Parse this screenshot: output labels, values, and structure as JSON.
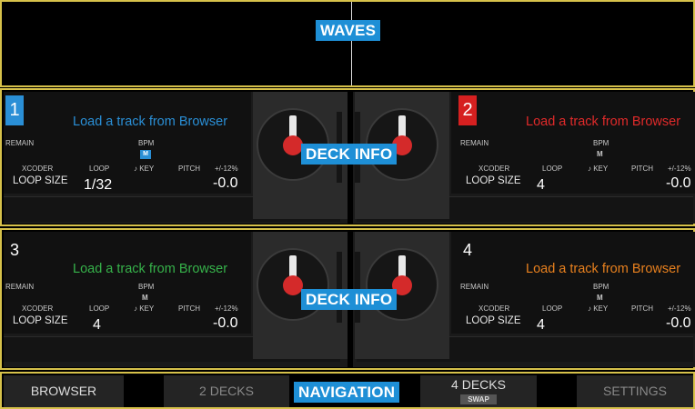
{
  "overlays": {
    "waves": "WAVES",
    "deck_info": "DECK INFO",
    "navigation": "NAVIGATION"
  },
  "decks": [
    {
      "number": "1",
      "number_color": "#2a8fd6",
      "title": "Load a track from Browser",
      "title_color": "#2a8fd6",
      "remain_label": "REMAIN",
      "bpm_label": "BPM",
      "bpm_badge": "M",
      "xcoder_label": "XCODER",
      "loop_label": "LOOP",
      "key_label": "♪ KEY",
      "pitch_label": "PITCH",
      "range_label": "+/-12%",
      "loop_size_label": "LOOP SIZE",
      "loop_size_value": "1/32",
      "pitch_value": "-0.0"
    },
    {
      "number": "2",
      "number_color": "#d62020",
      "title": "Load a track from Browser",
      "title_color": "#e02a2a",
      "remain_label": "REMAIN",
      "bpm_label": "BPM",
      "bpm_badge": "M",
      "xcoder_label": "XCODER",
      "loop_label": "LOOP",
      "key_label": "♪ KEY",
      "pitch_label": "PITCH",
      "range_label": "+/-12%",
      "loop_size_label": "LOOP SIZE",
      "loop_size_value": "4",
      "pitch_value": "-0.0"
    },
    {
      "number": "3",
      "number_color": "",
      "title": "Load a track from Browser",
      "title_color": "#36b24a",
      "remain_label": "REMAIN",
      "bpm_label": "BPM",
      "bpm_badge": "M",
      "xcoder_label": "XCODER",
      "loop_label": "LOOP",
      "key_label": "♪ KEY",
      "pitch_label": "PITCH",
      "range_label": "+/-12%",
      "loop_size_label": "LOOP SIZE",
      "loop_size_value": "4",
      "pitch_value": "-0.0"
    },
    {
      "number": "4",
      "number_color": "",
      "title": "Load a track from Browser",
      "title_color": "#e8801e",
      "remain_label": "REMAIN",
      "bpm_label": "BPM",
      "bpm_badge": "M",
      "xcoder_label": "XCODER",
      "loop_label": "LOOP",
      "key_label": "♪ KEY",
      "pitch_label": "PITCH",
      "range_label": "+/-12%",
      "loop_size_label": "LOOP SIZE",
      "loop_size_value": "4",
      "pitch_value": "-0.0"
    }
  ],
  "nav": {
    "browser": "BROWSER",
    "two_decks": "2 DECKS",
    "four_decks": "4 DECKS",
    "swap": "SWAP",
    "settings": "SETTINGS"
  },
  "colors": {
    "frame": "#d6c14a",
    "overlay_blue": "#1e8fd6"
  }
}
